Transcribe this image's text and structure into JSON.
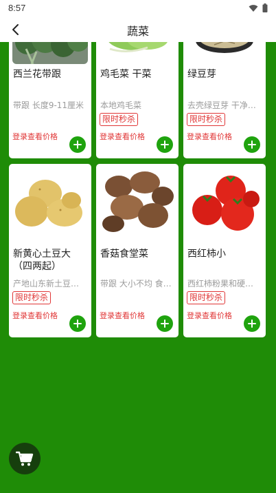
{
  "status_bar": {
    "time": "8:57",
    "icons": [
      "wifi-icon",
      "battery-icon"
    ]
  },
  "header": {
    "title": "蔬菜",
    "back_icon": "chevron-left-icon"
  },
  "products": [
    {
      "name": "西兰花带跟",
      "desc": "带跟 长度9-11厘米",
      "badge": "",
      "price_text": "登录查看价格",
      "image": "broccoli"
    },
    {
      "name": "鸡毛菜 干菜",
      "desc": "本地鸡毛菜",
      "badge": "限时秒杀",
      "price_text": "登录查看价格",
      "image": "greens"
    },
    {
      "name": "绿豆芽",
      "desc": "去壳绿豆芽 干净新鲜",
      "badge": "限时秒杀",
      "price_text": "登录查看价格",
      "image": "bean-sprouts"
    },
    {
      "name": "新黄心土豆大（四两起）",
      "desc": "产地山东新土豆四两起",
      "badge": "限时秒杀",
      "price_text": "登录查看价格",
      "image": "potato"
    },
    {
      "name": "香菇食堂菜",
      "desc": "带跟 大小不均 食堂菜",
      "badge": "",
      "price_text": "登录查看价格",
      "image": "shiitake"
    },
    {
      "name": "西红柿小",
      "desc": "西红柿粉果和硬果随机",
      "badge": "限时秒杀",
      "price_text": "登录查看价格",
      "image": "tomato"
    }
  ],
  "cart": {
    "icon": "cart-icon"
  },
  "colors": {
    "background": "#1f8c07",
    "accent_green": "#1fa30e",
    "price_red": "#e03535",
    "cart_fab": "#163f0d"
  }
}
